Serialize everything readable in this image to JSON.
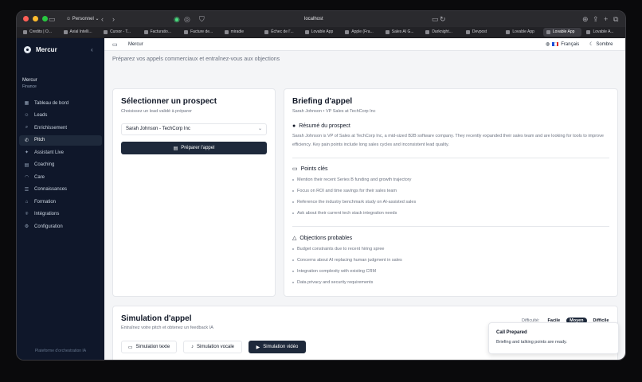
{
  "browser": {
    "profile": "Personnel",
    "url": "localhost",
    "tabs": [
      {
        "label": "Credits | O..."
      },
      {
        "label": "Axial Intelli..."
      },
      {
        "label": "Cursor - T..."
      },
      {
        "label": "Facturatio..."
      },
      {
        "label": "Facture de..."
      },
      {
        "label": "miradie"
      },
      {
        "label": "Échec de l'..."
      },
      {
        "label": "Lovable App"
      },
      {
        "label": "Apple (Fra..."
      },
      {
        "label": "Sales AI G..."
      },
      {
        "label": "Darknight..."
      },
      {
        "label": "Devpost"
      },
      {
        "label": "Lovable App"
      },
      {
        "label": "Lovable App"
      },
      {
        "label": "Lovable A..."
      }
    ],
    "colors": {
      "close": "#ff5f57",
      "minimize": "#febc2e",
      "maximize": "#28c840"
    }
  },
  "sidebar": {
    "brand": "Mercur",
    "org_name": "Mercur",
    "org_sub": "Finance",
    "items": [
      {
        "label": "Tableau de bord",
        "icon": "grid-icon",
        "glyph": "▦"
      },
      {
        "label": "Leads",
        "icon": "users-icon",
        "glyph": "☺"
      },
      {
        "label": "Enrichissement",
        "icon": "search-icon",
        "glyph": "⌕"
      },
      {
        "label": "Pitch",
        "icon": "phone-icon",
        "glyph": "✆"
      },
      {
        "label": "Assistant Live",
        "icon": "sparkles-icon",
        "glyph": "✦"
      },
      {
        "label": "Coaching",
        "icon": "chart-icon",
        "glyph": "▤"
      },
      {
        "label": "Care",
        "icon": "headset-icon",
        "glyph": "◠"
      },
      {
        "label": "Connaissances",
        "icon": "database-icon",
        "glyph": "☰"
      },
      {
        "label": "Formation",
        "icon": "graduation-cap-icon",
        "glyph": "⌂"
      },
      {
        "label": "Intégrations",
        "icon": "plug-icon",
        "glyph": "⌾"
      },
      {
        "label": "Configuration",
        "icon": "gear-icon",
        "glyph": "⚙"
      }
    ],
    "active": "Pitch",
    "footer": "Plateforme d'orchestration IA"
  },
  "topbar": {
    "breadcrumb": "Mercur",
    "language": "Français",
    "theme": "Sombre"
  },
  "page": {
    "subtitle": "Préparez vos appels commerciaux et entraînez-vous aux objections"
  },
  "prospect_card": {
    "title": "Sélectionner un prospect",
    "subtitle": "Choisissez un lead validé à préparer",
    "selected": "Sarah Johnson - TechCorp Inc",
    "button": "Préparer l'appel"
  },
  "briefing": {
    "title": "Briefing d'appel",
    "subtitle": "Sarah Johnson • VP Sales at TechCorp Inc",
    "summary_heading": "Résumé du prospect",
    "summary_text": "Sarah Johnson is VP of Sales at TechCorp Inc, a mid-sized B2B software company. They recently expanded their sales team and are looking for tools to improve efficiency. Key pain points include long sales cycles and inconsistent lead quality.",
    "key_points_heading": "Points clés",
    "key_points": [
      "Mention their recent Series B funding and growth trajectory",
      "Focus on ROI and time savings for their sales team",
      "Reference the industry benchmark study on AI-assisted sales",
      "Ask about their current tech stack integration needs"
    ],
    "objections_heading": "Objections probables",
    "objections": [
      "Budget constraints due to recent hiring spree",
      "Concerns about AI replacing human judgment in sales",
      "Integration complexity with existing CRM",
      "Data privacy and security requirements"
    ]
  },
  "simulation": {
    "title": "Simulation d'appel",
    "subtitle": "Entraînez votre pitch et obtenez un feedback IA",
    "difficulty_label": "Difficulté:",
    "difficulties": [
      "Facile",
      "Moyen",
      "Difficile"
    ],
    "difficulty_selected": "Moyen",
    "modes": [
      {
        "label": "Simulation texte",
        "icon": "message-icon"
      },
      {
        "label": "Simulation vocale",
        "icon": "mic-icon"
      },
      {
        "label": "Simulation vidéo",
        "icon": "video-icon"
      }
    ],
    "mode_selected": "Simulation vidéo"
  },
  "toast": {
    "title": "Call Prepared",
    "body": "Briefing and talking points are ready."
  },
  "accent": "#1e293b"
}
